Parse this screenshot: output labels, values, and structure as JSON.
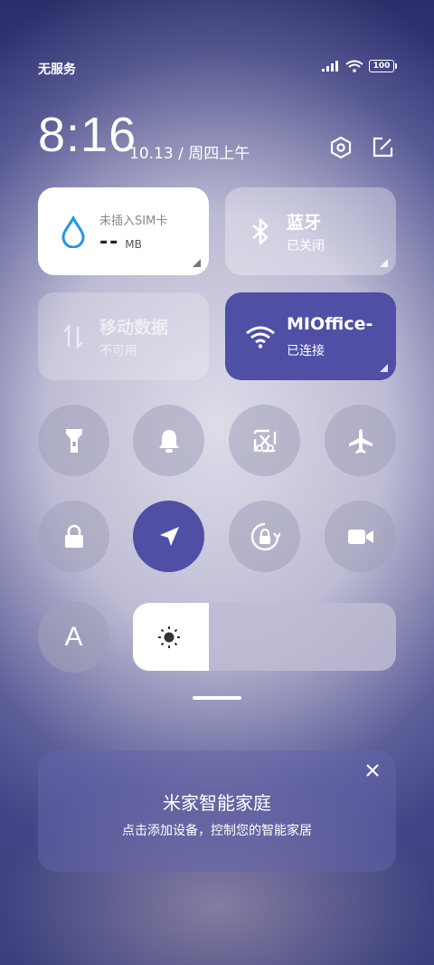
{
  "status_bar": {
    "carrier": "无服务",
    "battery": "100"
  },
  "header": {
    "time": "8:16",
    "date": "10.13 / 周四上午"
  },
  "tiles": {
    "data": {
      "title": "未插入SIM卡",
      "value": "--",
      "unit": "MB"
    },
    "bluetooth": {
      "title": "蓝牙",
      "status": "已关闭"
    },
    "mobile_data": {
      "title": "移动数据",
      "status": "不可用"
    },
    "wifi": {
      "title": "MIOffice-",
      "status": "已连接"
    }
  },
  "toggles": [
    {
      "icon": "flashlight-icon",
      "active": false
    },
    {
      "icon": "bell-icon",
      "active": false
    },
    {
      "icon": "screenshot-icon",
      "active": false
    },
    {
      "icon": "airplane-icon",
      "active": false
    },
    {
      "icon": "lock-icon",
      "active": false
    },
    {
      "icon": "location-icon",
      "active": true
    },
    {
      "icon": "rotation-lock-icon",
      "active": false
    },
    {
      "icon": "video-camera-icon",
      "active": false
    }
  ],
  "auto_brightness": {
    "label": "A"
  },
  "brightness": {
    "level": 0.29,
    "icon": "sun-icon"
  },
  "smart_home": {
    "title": "米家智能家庭",
    "subtitle": "点击添加设备，控制您的智能家居"
  },
  "colors": {
    "accent": "#4f4fa6",
    "tile_gray": "rgba(255,255,255,0.32)"
  }
}
